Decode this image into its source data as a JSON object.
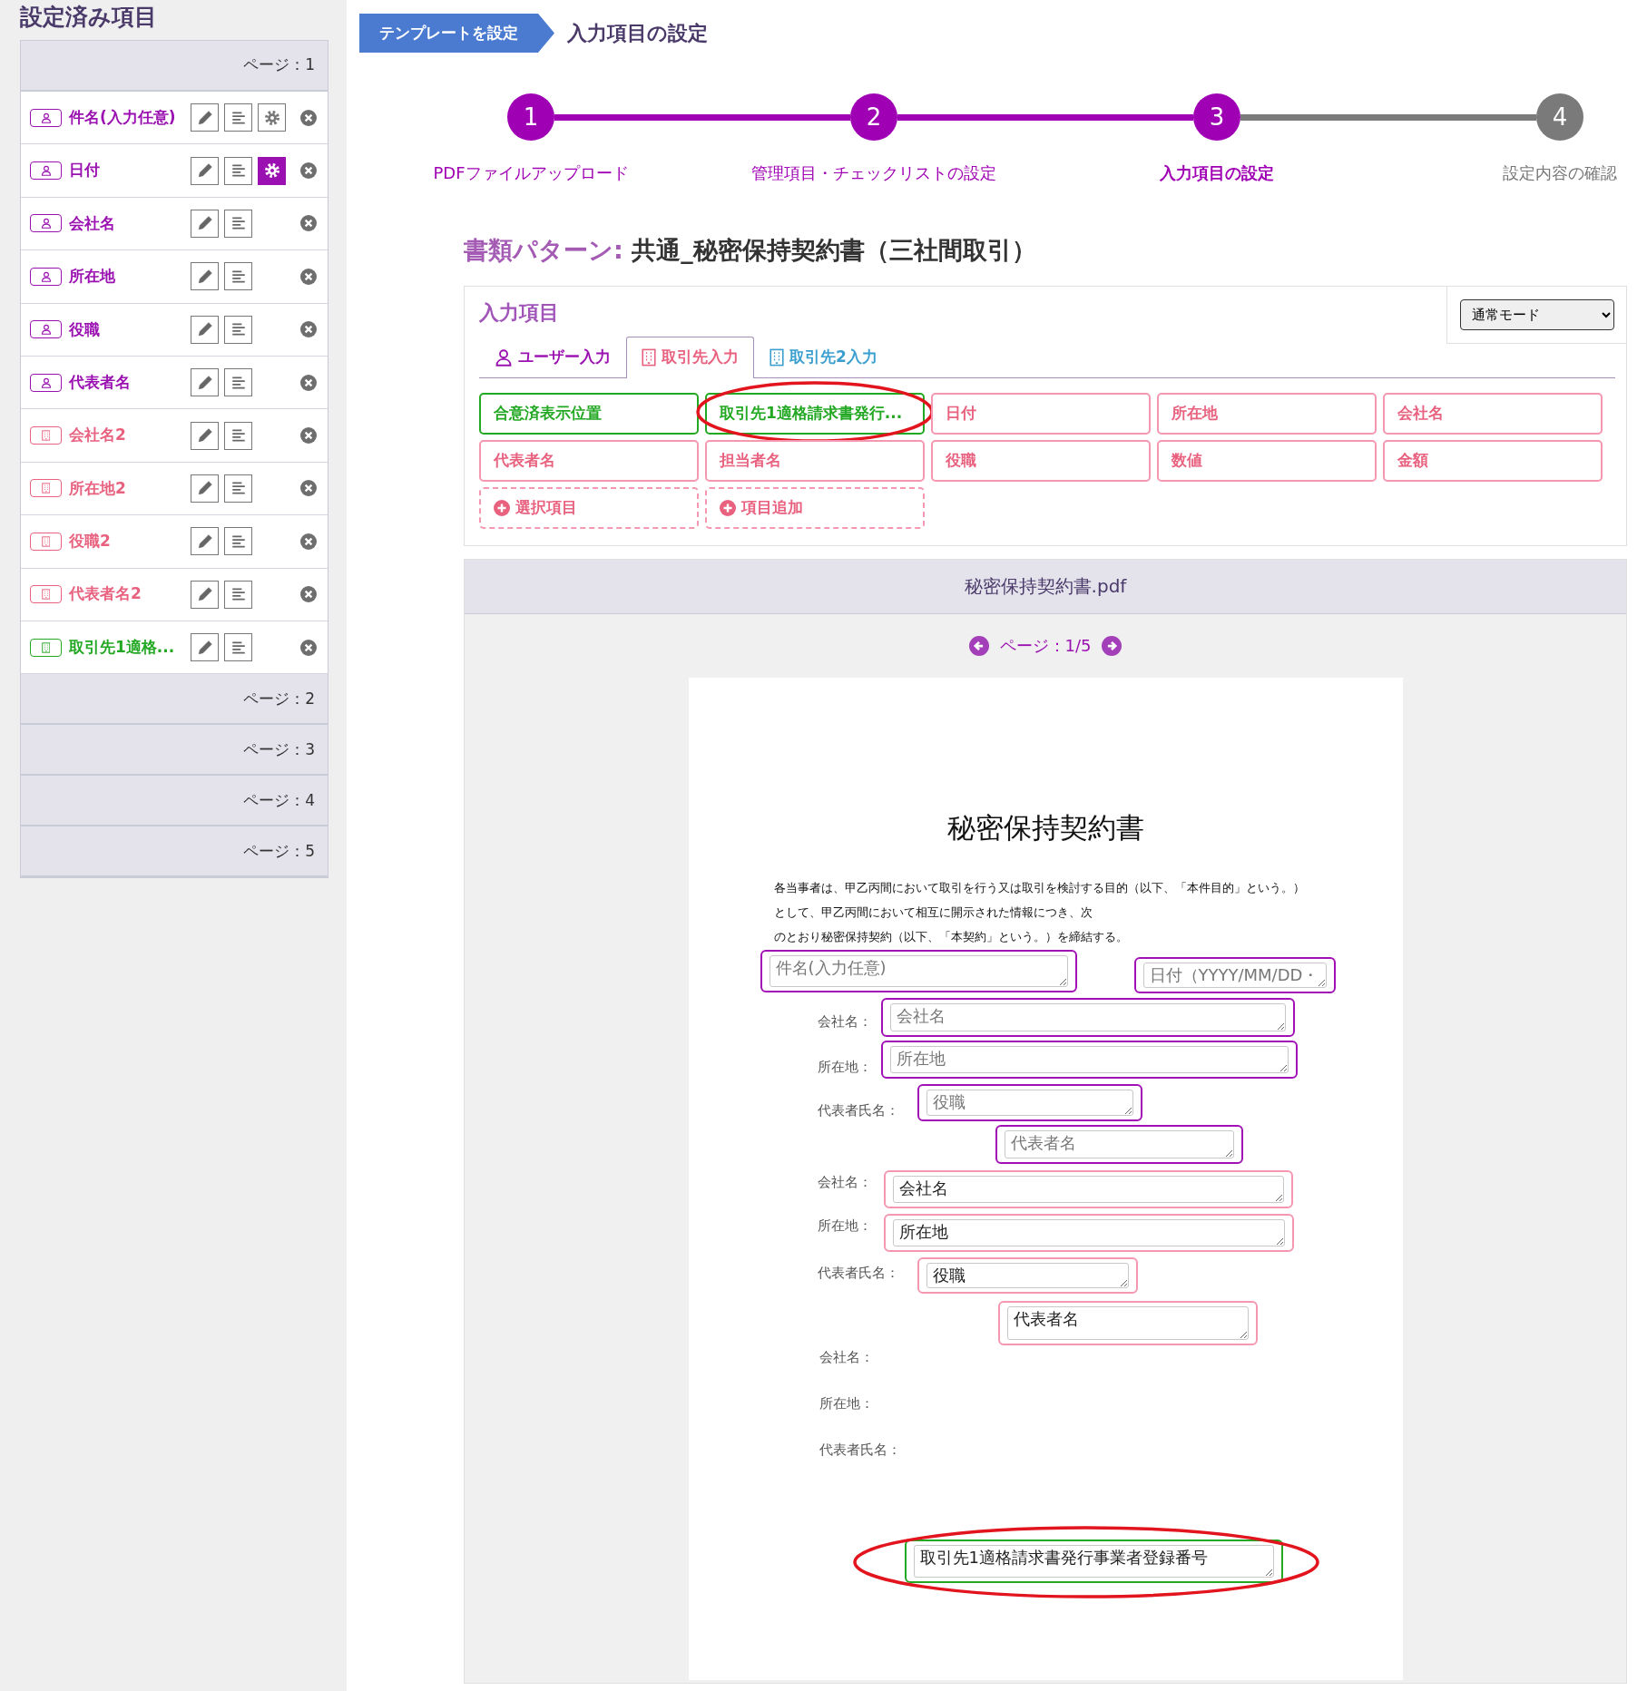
{
  "sidebar": {
    "title": "設定済み項目",
    "pages": [
      {
        "label": "ページ：1",
        "expanded": true,
        "items": [
          {
            "label": "件名(入力任意)",
            "kind": "user",
            "has_settings": true,
            "settings_active": false
          },
          {
            "label": "日付",
            "kind": "user",
            "has_settings": true,
            "settings_active": true
          },
          {
            "label": "会社名",
            "kind": "user",
            "has_settings": false
          },
          {
            "label": "所在地",
            "kind": "user",
            "has_settings": false
          },
          {
            "label": "役職",
            "kind": "user",
            "has_settings": false
          },
          {
            "label": "代表者名",
            "kind": "user",
            "has_settings": false
          },
          {
            "label": "会社名2",
            "kind": "partner",
            "has_settings": false
          },
          {
            "label": "所在地2",
            "kind": "partner",
            "has_settings": false
          },
          {
            "label": "役職2",
            "kind": "partner",
            "has_settings": false
          },
          {
            "label": "代表者名2",
            "kind": "partner",
            "has_settings": false
          },
          {
            "label": "取引先1適格...",
            "kind": "invoice",
            "has_settings": false
          }
        ]
      },
      {
        "label": "ページ：2",
        "expanded": false
      },
      {
        "label": "ページ：3",
        "expanded": false
      },
      {
        "label": "ページ：4",
        "expanded": false
      },
      {
        "label": "ページ：5",
        "expanded": false
      }
    ]
  },
  "breadcrumb": {
    "parent": "テンプレートを設定",
    "current": "入力項目の設定"
  },
  "steps": [
    {
      "number": "1",
      "label": "PDFファイルアップロード",
      "reached": true,
      "current": false
    },
    {
      "number": "2",
      "label": "管理項目・チェックリストの設定",
      "reached": true,
      "current": false
    },
    {
      "number": "3",
      "label": "入力項目の設定",
      "reached": true,
      "current": true
    },
    {
      "number": "4",
      "label": "設定内容の確認",
      "reached": false,
      "current": false
    }
  ],
  "document_pattern": {
    "label": "書類パターン:",
    "value": "共通_秘密保持契約書（三社間取引）"
  },
  "input_items": {
    "title": "入力項目",
    "mode": "通常モード",
    "tabs": [
      {
        "label": "ユーザー入力",
        "kind": "user",
        "selected": false
      },
      {
        "label": "取引先入力",
        "kind": "partner",
        "selected": true
      },
      {
        "label": "取引先2入力",
        "kind": "partner2",
        "selected": false
      }
    ],
    "buttons": [
      {
        "label": "合意済表示位置",
        "kind": "invoice",
        "circled": false
      },
      {
        "label": "取引先1適格請求書発行...",
        "kind": "invoice",
        "circled": true
      },
      {
        "label": "日付",
        "kind": "partner",
        "circled": false
      },
      {
        "label": "所在地",
        "kind": "partner",
        "circled": false
      },
      {
        "label": "会社名",
        "kind": "partner",
        "circled": false
      },
      {
        "label": "代表者名",
        "kind": "partner",
        "circled": false
      },
      {
        "label": "担当者名",
        "kind": "partner",
        "circled": false
      },
      {
        "label": "役職",
        "kind": "partner",
        "circled": false
      },
      {
        "label": "数値",
        "kind": "partner",
        "circled": false
      },
      {
        "label": "金額",
        "kind": "partner",
        "circled": false
      },
      {
        "label": "選択項目",
        "kind": "add",
        "circled": false
      },
      {
        "label": "項目追加",
        "kind": "add",
        "circled": false
      }
    ]
  },
  "pdf": {
    "filename": "秘密保持契約書.pdf",
    "page": "ページ：1/5",
    "page_content": {
      "title": "秘密保持契約書",
      "paragraph": [
        "各当事者は、甲乙丙間において取引を行う又は取引を検討する目的（以下、「本件目的」という。）",
        "として、甲乙丙間において相互に開示された情報につき、次",
        "のとおり秘密保持契約（以下、「本契約」という。）を締結する。"
      ],
      "labels": [
        "会社名：",
        "所在地：",
        "代表者氏名：",
        "会社名：",
        "所在地：",
        "代表者氏名：",
        "会社名：",
        "所在地：",
        "代表者氏名："
      ],
      "fields": [
        {
          "kind": "user",
          "placeholder": "件名(入力任意)",
          "circled": false
        },
        {
          "kind": "user",
          "placeholder": "日付（YYYY/MM/DD・",
          "circled": false
        },
        {
          "kind": "user",
          "placeholder": "会社名",
          "circled": false
        },
        {
          "kind": "user",
          "placeholder": "所在地",
          "circled": false
        },
        {
          "kind": "user",
          "placeholder": "役職",
          "circled": false
        },
        {
          "kind": "user",
          "placeholder": "代表者名",
          "circled": false
        },
        {
          "kind": "partner",
          "value": "会社名",
          "circled": false
        },
        {
          "kind": "partner",
          "value": "所在地",
          "circled": false
        },
        {
          "kind": "partner",
          "value": "役職",
          "circled": false
        },
        {
          "kind": "partner",
          "value": "代表者名",
          "circled": false
        },
        {
          "kind": "invoice",
          "value": "取引先1適格請求書発行事業者登録番号",
          "circled": true
        }
      ]
    }
  }
}
